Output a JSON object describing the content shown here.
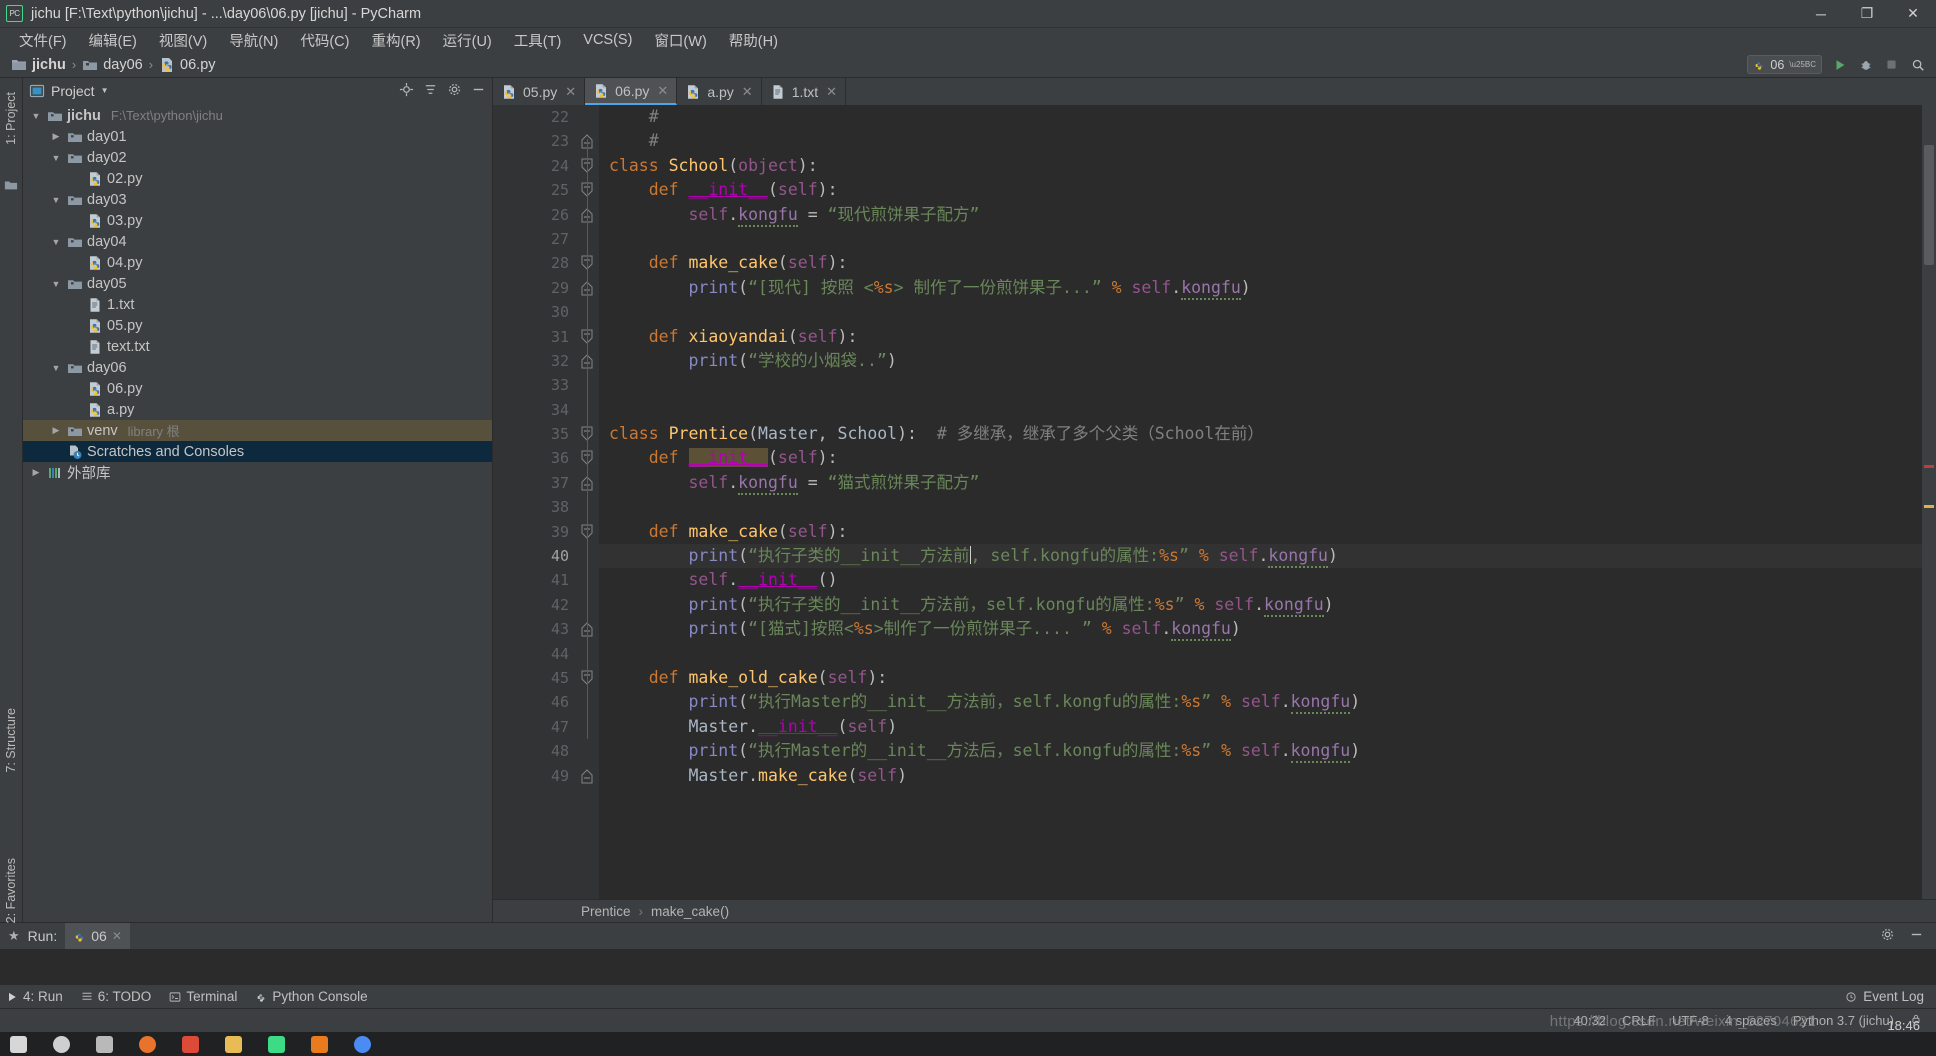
{
  "window": {
    "title": "jichu [F:\\Text\\python\\jichu] - ...\\day06\\06.py [jichu] - PyCharm",
    "app_icon": "pycharm-logo-icon",
    "minimize": "─",
    "maximize": "❐",
    "close": "✕"
  },
  "menubar": [
    {
      "label": "文件(F)"
    },
    {
      "label": "编辑(E)"
    },
    {
      "label": "视图(V)"
    },
    {
      "label": "导航(N)"
    },
    {
      "label": "代码(C)"
    },
    {
      "label": "重构(R)"
    },
    {
      "label": "运行(U)"
    },
    {
      "label": "工具(T)"
    },
    {
      "label": "VCS(S)"
    },
    {
      "label": "窗口(W)"
    },
    {
      "label": "帮助(H)"
    }
  ],
  "navbar": {
    "crumbs": [
      "jichu",
      "day06",
      "06.py"
    ],
    "separator": "›",
    "run_config": "06",
    "run_button": "run-icon",
    "debug_button": "debug-icon",
    "stop_button": "stop-icon",
    "search_button": "search-icon"
  },
  "left_rail": {
    "project_label": "1: Project",
    "structure_label": "7: Structure",
    "favorites_label": "2: Favorites"
  },
  "project_panel": {
    "header": "Project",
    "tree": [
      {
        "indent": 0,
        "arrow": "▼",
        "icon": "folder-icon",
        "label": "jichu",
        "sub": "F:\\Text\\python\\jichu",
        "state": "none"
      },
      {
        "indent": 1,
        "arrow": "▶",
        "icon": "folder-icon",
        "label": "day01",
        "sub": "",
        "state": "none"
      },
      {
        "indent": 1,
        "arrow": "▼",
        "icon": "folder-icon",
        "label": "day02",
        "sub": "",
        "state": "none"
      },
      {
        "indent": 2,
        "arrow": "",
        "icon": "python-file-icon",
        "label": "02.py",
        "sub": "",
        "state": "none"
      },
      {
        "indent": 1,
        "arrow": "▼",
        "icon": "folder-icon",
        "label": "day03",
        "sub": "",
        "state": "none"
      },
      {
        "indent": 2,
        "arrow": "",
        "icon": "python-file-icon",
        "label": "03.py",
        "sub": "",
        "state": "none"
      },
      {
        "indent": 1,
        "arrow": "▼",
        "icon": "folder-icon",
        "label": "day04",
        "sub": "",
        "state": "none"
      },
      {
        "indent": 2,
        "arrow": "",
        "icon": "python-file-icon",
        "label": "04.py",
        "sub": "",
        "state": "none"
      },
      {
        "indent": 1,
        "arrow": "▼",
        "icon": "folder-icon",
        "label": "day05",
        "sub": "",
        "state": "none"
      },
      {
        "indent": 2,
        "arrow": "",
        "icon": "text-file-icon",
        "label": "1.txt",
        "sub": "",
        "state": "none"
      },
      {
        "indent": 2,
        "arrow": "",
        "icon": "python-file-icon",
        "label": "05.py",
        "sub": "",
        "state": "none"
      },
      {
        "indent": 2,
        "arrow": "",
        "icon": "text-file-icon",
        "label": "text.txt",
        "sub": "",
        "state": "none"
      },
      {
        "indent": 1,
        "arrow": "▼",
        "icon": "folder-icon",
        "label": "day06",
        "sub": "",
        "state": "none"
      },
      {
        "indent": 2,
        "arrow": "",
        "icon": "python-file-icon",
        "label": "06.py",
        "sub": "",
        "state": "none"
      },
      {
        "indent": 2,
        "arrow": "",
        "icon": "python-file-icon",
        "label": "a.py",
        "sub": "",
        "state": "none"
      },
      {
        "indent": 1,
        "arrow": "▶",
        "icon": "folder-icon",
        "label": "venv",
        "sub": "library 根",
        "state": "brown"
      },
      {
        "indent": 1,
        "arrow": "",
        "icon": "scratches-icon",
        "label": "Scratches and Consoles",
        "sub": "",
        "state": "blue"
      },
      {
        "indent": 0,
        "arrow": "▶",
        "icon": "library-icon",
        "label": "外部库",
        "sub": "",
        "state": "none"
      }
    ]
  },
  "editor": {
    "tabs": [
      {
        "label": "05.py",
        "icon": "python-file-icon",
        "active": false
      },
      {
        "label": "06.py",
        "icon": "python-file-icon",
        "active": true
      },
      {
        "label": "a.py",
        "icon": "python-file-icon",
        "active": false
      },
      {
        "label": "1.txt",
        "icon": "text-file-icon",
        "active": false
      }
    ],
    "close_glyph": "✕",
    "first_line": 22,
    "current_line": 40,
    "breadcrumb": [
      "Prentice",
      "make_cake()"
    ],
    "breadcrumb_sep": "›",
    "lines": [
      {
        "n": 22,
        "text": "    #"
      },
      {
        "n": 23,
        "text": "    #"
      },
      {
        "n": 24,
        "text": "class School(object):"
      },
      {
        "n": 25,
        "text": "    def __init__(self):"
      },
      {
        "n": 26,
        "text": "        self.kongfu = “现代煎饼果子配方”"
      },
      {
        "n": 27,
        "text": ""
      },
      {
        "n": 28,
        "text": "    def make_cake(self):"
      },
      {
        "n": 29,
        "text": "        print(“[现代] 按照 <%s> 制作了一份煎饼果子...” % self.kongfu)"
      },
      {
        "n": 30,
        "text": ""
      },
      {
        "n": 31,
        "text": "    def xiaoyandai(self):"
      },
      {
        "n": 32,
        "text": "        print(“学校的小烟袋..”)"
      },
      {
        "n": 33,
        "text": ""
      },
      {
        "n": 34,
        "text": ""
      },
      {
        "n": 35,
        "text": "class Prentice(Master, School):  # 多继承，继承了多个父类（School在前）"
      },
      {
        "n": 36,
        "text": "    def __init__(self):"
      },
      {
        "n": 37,
        "text": "        self.kongfu = “猫式煎饼果子配方”"
      },
      {
        "n": 38,
        "text": ""
      },
      {
        "n": 39,
        "text": "    def make_cake(self):"
      },
      {
        "n": 40,
        "text": "        print(“执行子类的__init__方法前, self.kongfu的属性:%s” % self.kongfu)"
      },
      {
        "n": 41,
        "text": "        self.__init__()"
      },
      {
        "n": 42,
        "text": "        print(“执行子类的__init__方法前，self.kongfu的属性:%s” % self.kongfu)"
      },
      {
        "n": 43,
        "text": "        print(“[猫式]按照<%s>制作了一份煎饼果子.... ” % self.kongfu)"
      },
      {
        "n": 44,
        "text": ""
      },
      {
        "n": 45,
        "text": "    def make_old_cake(self):"
      },
      {
        "n": 46,
        "text": "        print(“执行Master的__init__方法前，self.kongfu的属性:%s” % self.kongfu)"
      },
      {
        "n": 47,
        "text": "        Master.__init__(self)"
      },
      {
        "n": 48,
        "text": "        print(“执行Master的__init__方法后，self.kongfu的属性:%s” % self.kongfu)"
      },
      {
        "n": 49,
        "text": "        Master.make_cake(self)"
      }
    ]
  },
  "run_panel": {
    "label": "Run:",
    "tab": "06",
    "tab_icon": "python-file-icon",
    "close_glyph": "✕",
    "settings_icon": "gear-icon",
    "minimize_icon": "minimize-icon"
  },
  "bottom_bar": {
    "items": [
      {
        "icon": "run-icon",
        "label": "4: Run"
      },
      {
        "icon": "todo-icon",
        "label": "6: TODO"
      },
      {
        "icon": "terminal-icon",
        "label": "Terminal"
      },
      {
        "icon": "python-console-icon",
        "label": "Python Console"
      }
    ],
    "event_log": "Event Log",
    "event_log_icon": "bell-icon"
  },
  "statusbar": {
    "caret_position": "40:32",
    "line_separator": "CRLF",
    "encoding": "UTF-8",
    "indent": "4 spaces",
    "interpreter": "Python 3.7 (jichu)",
    "lock_icon": "lock-icon"
  },
  "watermark": "https://blog.csdn.net/weixin_52704621",
  "clock": {
    "time": "18:46"
  },
  "colors": {
    "bg_panel": "#3c3f41",
    "bg_editor": "#2b2b2b",
    "bg_gutter": "#313335",
    "accent_tab": "#4ea6e8",
    "keyword": "#cc7832",
    "string": "#6a8759",
    "function": "#ffc66d",
    "self": "#94558d",
    "comment": "#808080",
    "selection_brown": "#57503c",
    "selection_blue": "#0d293e",
    "logo_green": "#3ddb85"
  }
}
